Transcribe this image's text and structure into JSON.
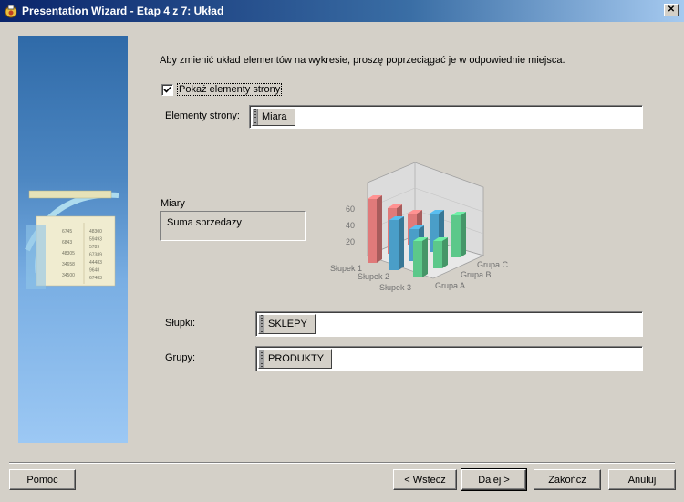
{
  "window": {
    "title": "Presentation Wizard - Etap 4 z 7: Układ",
    "close_icon": "close-icon"
  },
  "intro_text": "Aby zmienić układ elementów na wykresie, proszę poprzeciągać je w odpowiednie miejsca.",
  "show_page_items": {
    "label": "Pokaż elementy strony",
    "checked": true
  },
  "page_items": {
    "label": "Elementy strony:",
    "chip": "Miara"
  },
  "measures": {
    "label": "Miary",
    "value": "Suma sprzedazy"
  },
  "columns": {
    "label": "Słupki:",
    "chip": "SKLEPY"
  },
  "groups": {
    "label": "Grupy:",
    "chip": "PRODUKTY"
  },
  "preview_chart": {
    "y_ticks": [
      "20",
      "40",
      "60"
    ],
    "columns": [
      "Słupek 1",
      "Słupek 2",
      "Słupek 3"
    ],
    "groups": [
      "Grupa A",
      "Grupa B",
      "Grupa C"
    ],
    "colors": {
      "series1": "#e07a7a",
      "series2": "#4a9ec8",
      "series3": "#5cc88a"
    }
  },
  "side_panel_numbers": {
    "col1": [
      "6745",
      "6843",
      "48305",
      "34658",
      "34500"
    ],
    "col2": [
      "48300",
      "59493",
      "5789",
      "67389",
      "44483",
      "9648",
      "67483"
    ]
  },
  "buttons": {
    "help": "Pomoc",
    "back": "< Wstecz",
    "next": "Dalej >",
    "finish": "Zakończ",
    "cancel": "Anuluj"
  }
}
